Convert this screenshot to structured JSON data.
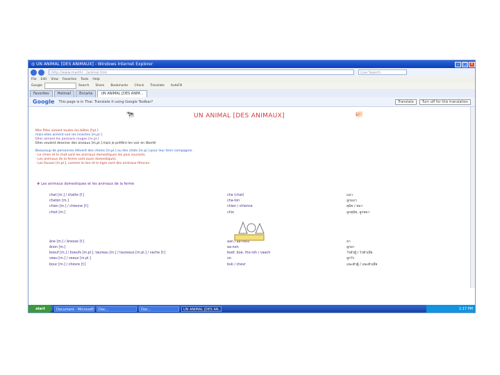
{
  "window": {
    "title": "UN ANIMAL [DES ANIMAUX] - Windows Internet Explorer",
    "icon": "ie-icon"
  },
  "address": {
    "url": "http://www.marthi.../animal.htm",
    "search_placeholder": "Live Search"
  },
  "menu": [
    "File",
    "Edit",
    "View",
    "Favorites",
    "Tools",
    "Help"
  ],
  "google_toolbar": {
    "label": "Google",
    "items": [
      "Search",
      "Share",
      "Bookmarks",
      "Check",
      "Translate",
      "AutoFill"
    ]
  },
  "tabs": [
    "Favorites",
    "Hotmail",
    "Encarta",
    "UN ANIMAL [DES ANIM..."
  ],
  "translate_bar": {
    "logo": "Google",
    "text": "This page is in Thai. Translate it using Google Toolbar?",
    "translate_btn": "Translate",
    "turn_off_btn": "Turn off for this translation"
  },
  "page": {
    "heading": "UN ANIMAL [DES ANIMAUX]",
    "lines": [
      {
        "text": "Mes filles aiment toutes les bêtes [f.pl.]",
        "color": "red"
      },
      {
        "text": "mais elles aiment voir les insectes [m.pl.]",
        "color": "blue"
      },
      {
        "text": "Elles aiment les poissons rouges [m.pl.]",
        "color": "purple"
      },
      {
        "text": "Elles veulent dessiner des oiseaux [m.pl.] mais je préfère les voir en liberté",
        "color": "dark"
      },
      {
        "text": "Beaucoup de personnes élèvent des chiens [m.pl.] ou des chats [m.pl.] pour leur tenir compagnie.",
        "color": "blue"
      },
      {
        "text": "- Le chien et le chat sont les animaux domestiques les plus courants.",
        "color": "red"
      },
      {
        "text": "- Les animaux de la ferme sont aussi domestiques.",
        "color": "red"
      },
      {
        "text": "- Les fauves [m.pl.], comme le lion et le tigre sont des animaux féroces.",
        "color": "red"
      }
    ],
    "section": "Les animaux domestiques et les animaux de la ferme",
    "vocab": [
      {
        "fr": "chat [m.] / chatte [f.]",
        "pron": "cha (chat)",
        "th": "แมว"
      },
      {
        "fr": "chaton [m.]",
        "pron": "cha-ton",
        "th": "ลูกแมว"
      },
      {
        "fr": "chien [m.] / chienne [f.]",
        "pron": "chien / chienne",
        "th": "สุนัข / หมา"
      },
      {
        "fr": "chiot [m.]",
        "pron": "chio",
        "th": "ลูกสุนัข, ลูกหมา"
      },
      {
        "fr": "",
        "pron": "",
        "th": ""
      },
      {
        "fr": "âne [m.] / ânesse [f.]",
        "pron": "aan / aa-ness",
        "th": "ลา"
      },
      {
        "fr": "ânon [m.]",
        "pron": "aa-non",
        "th": "ลูกลา"
      },
      {
        "fr": "boeuf [m.] / boeufs [m.pl.], taureau [m.] / taureaux [m.pl.] / vache [f.]",
        "pron": "boef, boe, tho-roh / vaach",
        "th": "วัวตัวผู้ / วัวตัวเมีย"
      },
      {
        "fr": "veau [m.] / veaux [m.pl.]",
        "pron": "vo",
        "th": "ลูกวัว"
      },
      {
        "fr": "bouc [m.] / chèvre [f.]",
        "pron": "buk / chevr",
        "th": "แพะตัวผู้ / แพะตัวเมีย"
      }
    ]
  },
  "taskbar": {
    "start": "start",
    "items": [
      "Document - Microsoft",
      "Doc...",
      "Doc...",
      "UN ANIMAL [DES AN..."
    ],
    "clock": "1:17 PM"
  }
}
